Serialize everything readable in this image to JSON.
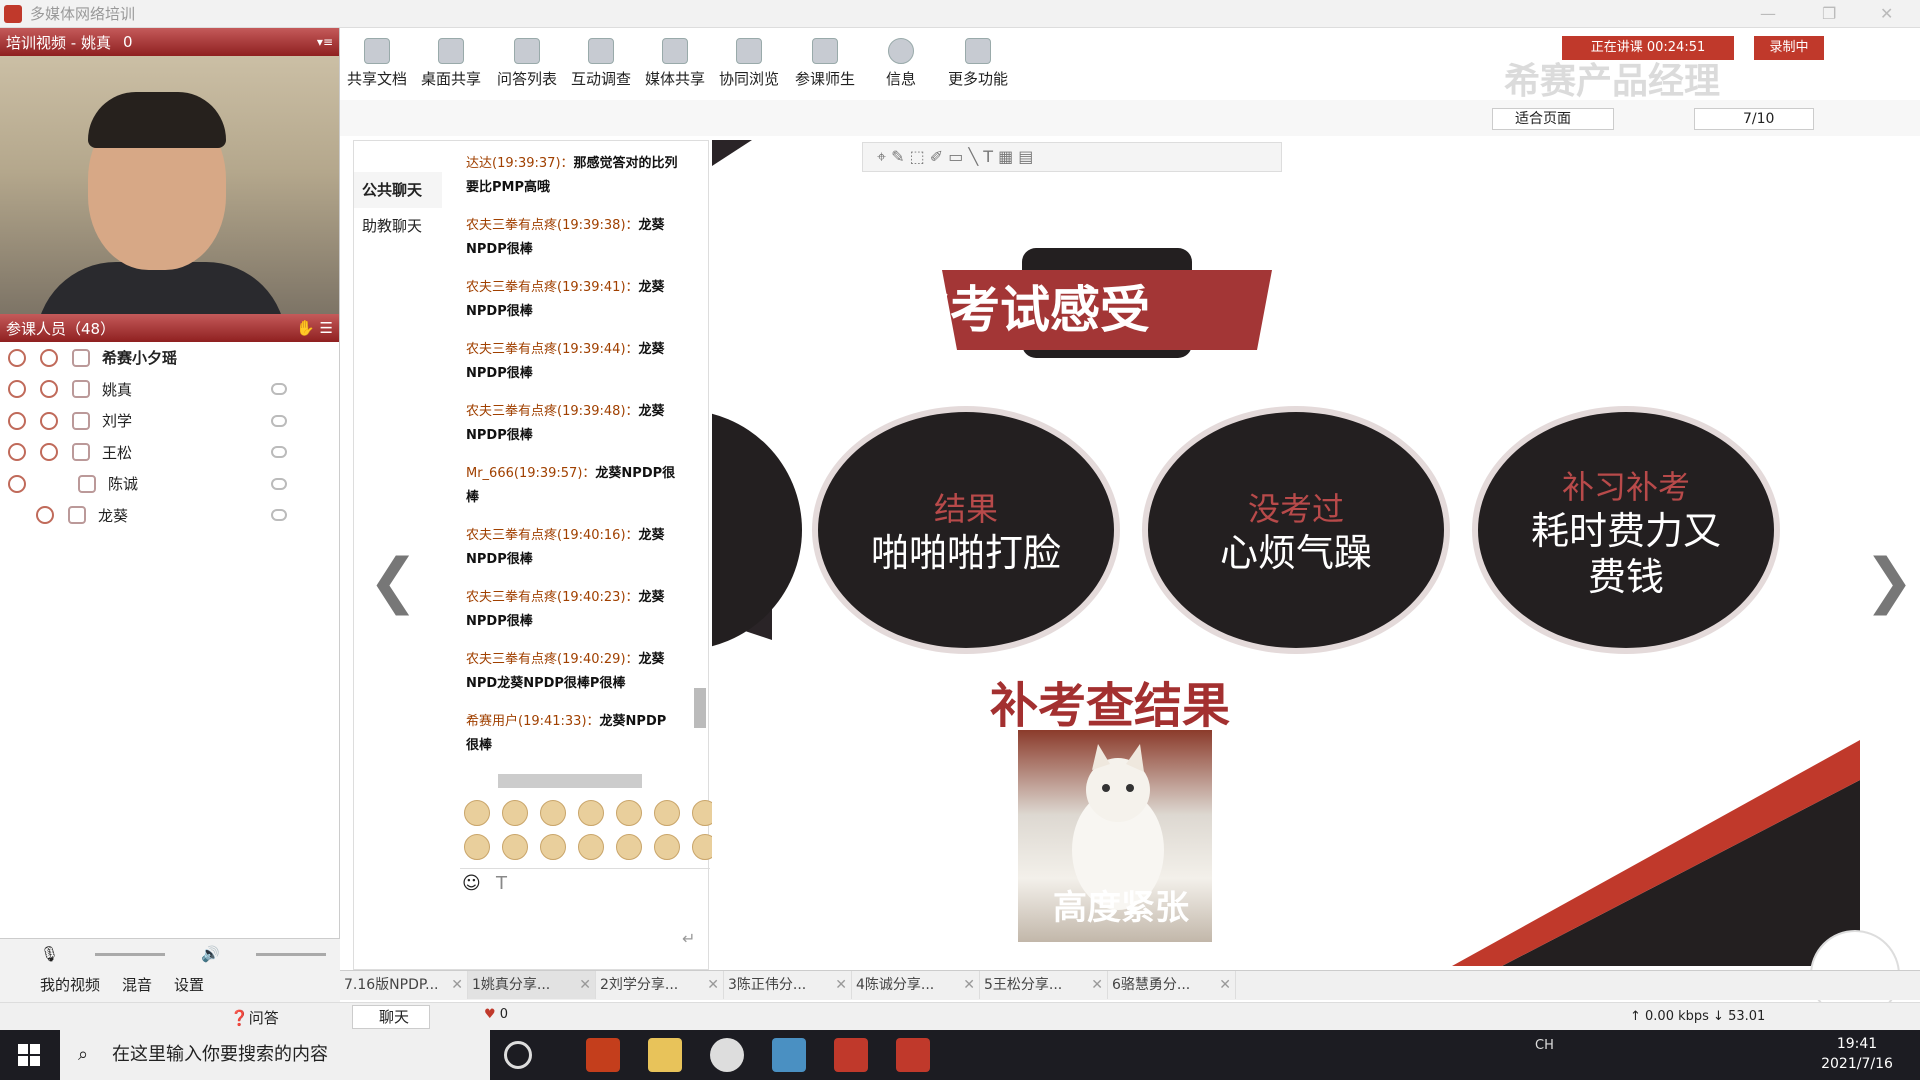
{
  "window": {
    "title": "多媒体网络培训"
  },
  "left_panel": {
    "video_header": "培训视频 - 姚真",
    "video_count": "0",
    "participants_header": "参课人员（48）",
    "participants": [
      {
        "name": "希赛小夕瑶"
      },
      {
        "name": "姚真"
      },
      {
        "name": "刘学"
      },
      {
        "name": "王松"
      },
      {
        "name": "陈诚"
      },
      {
        "name": "龙葵"
      }
    ],
    "controls": {
      "my_video": "我的视频",
      "mix": "混音",
      "settings": "设置"
    },
    "tabs": {
      "qa": "问答",
      "chat": "聊天",
      "likes": "0"
    }
  },
  "toolbar": {
    "buttons": [
      "共享文档",
      "桌面共享",
      "问答列表",
      "互动调查",
      "媒体共享",
      "协同浏览",
      "参课师生",
      "信息",
      "更多功能"
    ],
    "status": "正在讲课 00:24:51",
    "record": "录制中",
    "watermark": "希赛产品经理"
  },
  "viewbar": {
    "fit": "适合页面",
    "page": "7/10"
  },
  "chat": {
    "tabs": [
      "公共聊天",
      "助教聊天"
    ],
    "messages": [
      {
        "who": "达达(19:39:37)：",
        "text": "那感觉答对的比列要比PMP高哦"
      },
      {
        "who": "农夫三拳有点疼(19:39:38)：",
        "text": "龙葵NPDP很棒"
      },
      {
        "who": "农夫三拳有点疼(19:39:41)：",
        "text": "龙葵NPDP很棒"
      },
      {
        "who": "农夫三拳有点疼(19:39:44)：",
        "text": "龙葵NPDP很棒"
      },
      {
        "who": "农夫三拳有点疼(19:39:48)：",
        "text": "龙葵NPDP很棒"
      },
      {
        "who": "Mr_666(19:39:57)：",
        "text": "龙葵NPDP很棒"
      },
      {
        "who": "农夫三拳有点疼(19:40:16)：",
        "text": "龙葵NPDP很棒"
      },
      {
        "who": "农夫三拳有点疼(19:40:23)：",
        "text": "龙葵NPDP很棒"
      },
      {
        "who": "农夫三拳有点疼(19:40:29)：",
        "text": "龙葵NPD龙葵NPDP很棒P很棒"
      },
      {
        "who": "希赛用户(19:41:33)：",
        "text": "龙葵NPDP很棒"
      }
    ]
  },
  "slide": {
    "title": "两次考试感受",
    "circles": [
      {
        "label": "结果",
        "text": "啪啪啪打脸"
      },
      {
        "label": "没考过",
        "text": "心烦气躁"
      },
      {
        "label": "补习补考",
        "text": "耗时费力又费钱"
      }
    ],
    "subtitle": "补考查结果",
    "image_caption": "高度紧张"
  },
  "doc_tabs": [
    "7.16版NPDP...",
    "1姚真分享...",
    "2刘学分享...",
    "3陈正伟分...",
    "4陈诚分享...",
    "5王松分享...",
    "6骆慧勇分..."
  ],
  "network": {
    "up": "0.00 kbps",
    "down": "53.01"
  },
  "taskbar": {
    "search_placeholder": "在这里输入你要搜索的内容",
    "ime": "CH",
    "time": "19:41",
    "date": "2021/7/16"
  }
}
